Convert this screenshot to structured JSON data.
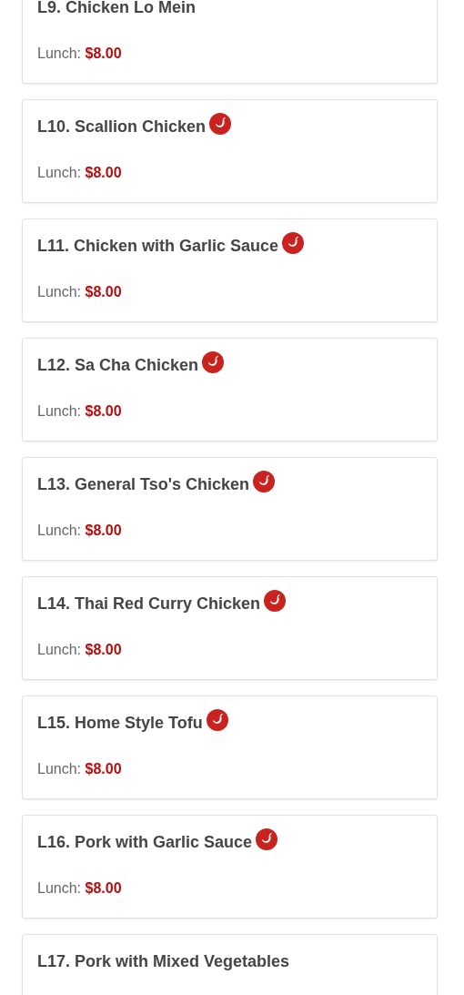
{
  "items": [
    {
      "name": "L9. Chicken Lo Mein",
      "spicy": false,
      "price_label": "Lunch:",
      "price": "$8.00"
    },
    {
      "name": "L10. Scallion Chicken",
      "spicy": true,
      "price_label": "Lunch:",
      "price": "$8.00"
    },
    {
      "name": "L11. Chicken with Garlic Sauce",
      "spicy": true,
      "price_label": "Lunch:",
      "price": "$8.00"
    },
    {
      "name": "L12. Sa Cha Chicken",
      "spicy": true,
      "price_label": "Lunch:",
      "price": "$8.00"
    },
    {
      "name": "L13. General Tso's Chicken",
      "spicy": true,
      "price_label": "Lunch:",
      "price": "$8.00"
    },
    {
      "name": "L14. Thai Red Curry Chicken",
      "spicy": true,
      "price_label": "Lunch:",
      "price": "$8.00"
    },
    {
      "name": "L15. Home Style Tofu",
      "spicy": true,
      "price_label": "Lunch:",
      "price": "$8.00"
    },
    {
      "name": "L16. Pork with Garlic Sauce",
      "spicy": true,
      "price_label": "Lunch:",
      "price": "$8.00"
    },
    {
      "name": "L17. Pork with Mixed Vegetables",
      "spicy": false
    }
  ]
}
